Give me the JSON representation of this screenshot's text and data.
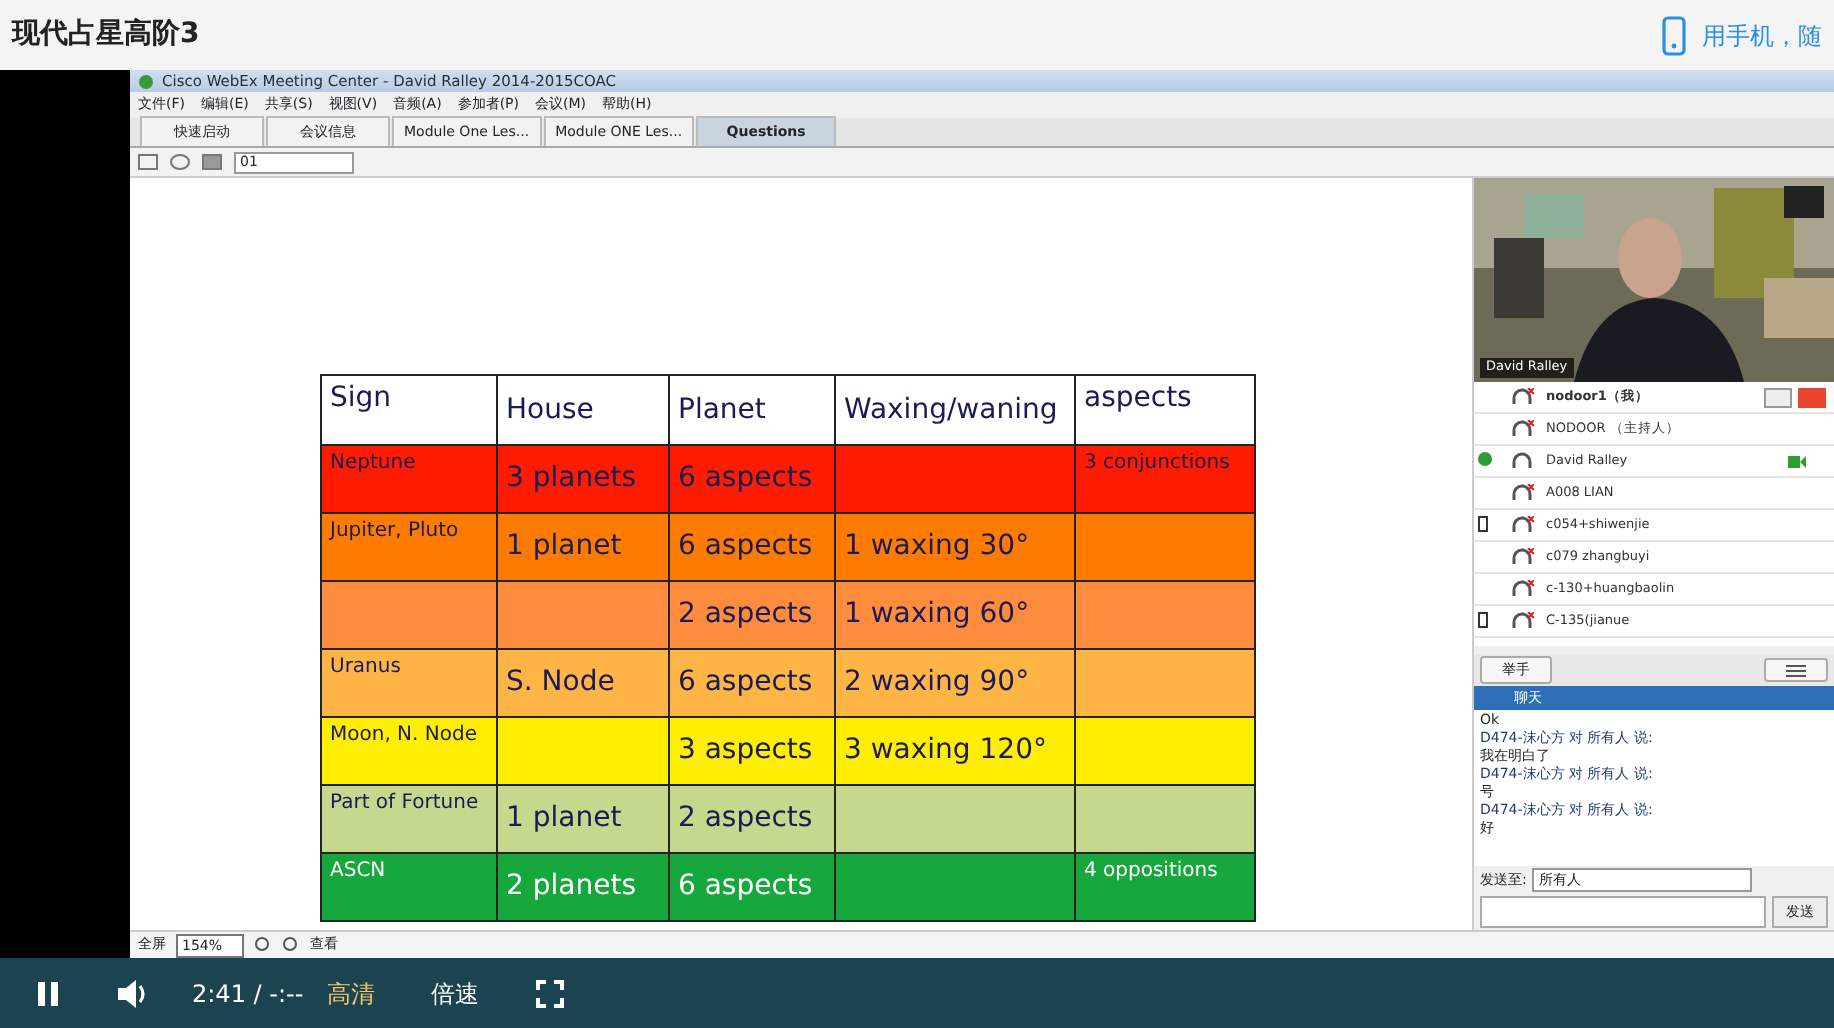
{
  "page": {
    "title": "现代占星高阶3",
    "mobile_link": "用手机，随"
  },
  "recording": {
    "window_title": "Cisco WebEx Meeting Center - David Ralley 2014-2015COAC",
    "menu": [
      "文件(F)",
      "编辑(E)",
      "共享(S)",
      "视图(V)",
      "音频(A)",
      "参加者(P)",
      "会议(M)",
      "帮助(H)"
    ],
    "tabs": [
      {
        "label": "快速启动",
        "selected": false
      },
      {
        "label": "会议信息",
        "selected": false
      },
      {
        "label": "Module One Les...",
        "selected": false
      },
      {
        "label": "Module ONE Les...",
        "selected": false
      },
      {
        "label": "Questions",
        "selected": true
      }
    ],
    "page_select": "01",
    "table": {
      "columns": [
        "Sign",
        "House",
        "Planet",
        "Waxing/waning",
        "aspects"
      ],
      "rows": [
        {
          "color": "#ff1a00",
          "cells": [
            "Neptune",
            "3 planets",
            "6 aspects",
            "",
            "3 conjunctions"
          ]
        },
        {
          "color": "#ff7b00",
          "cells": [
            "Jupiter, Pluto",
            "1 planet",
            "6 aspects",
            "1 waxing 30°",
            ""
          ]
        },
        {
          "color": "#ff8c3c",
          "cells": [
            "",
            "",
            "2 aspects",
            "1 waxing 60°",
            ""
          ]
        },
        {
          "color": "#ffb446",
          "cells": [
            "Uranus",
            "S. Node",
            "6 aspects",
            "2 waxing 90°",
            ""
          ]
        },
        {
          "color": "#ffee00",
          "cells": [
            "Moon, N. Node",
            "",
            "3 aspects",
            "3 waxing 120°",
            ""
          ]
        },
        {
          "color": "#c4d98c",
          "cells": [
            "Part of Fortune",
            "1 planet",
            "2 aspects",
            "",
            ""
          ]
        },
        {
          "color": "#16a83c",
          "cells": [
            "ASCN",
            "2 planets",
            "6 aspects",
            "",
            "4 oppositions"
          ]
        }
      ]
    },
    "bottom_toolbar": {
      "fullscreen": "全屏",
      "zoom": "154%",
      "view": "查看"
    },
    "video": {
      "presenter": "David Ralley"
    },
    "participants": [
      {
        "name": "nodoor1（我）",
        "kind": "self",
        "on_phone": false,
        "on_web": false,
        "muted": true
      },
      {
        "name": "NODOOR （主持人）",
        "kind": "other",
        "on_phone": false,
        "on_web": false,
        "muted": true
      },
      {
        "name": "David Ralley",
        "kind": "presenter",
        "on_phone": false,
        "on_web": true,
        "muted": false
      },
      {
        "name": "A008 LIAN",
        "kind": "other",
        "on_phone": false,
        "on_web": false,
        "muted": true
      },
      {
        "name": "c054+shiwenjie",
        "kind": "other",
        "on_phone": true,
        "on_web": false,
        "muted": true
      },
      {
        "name": "c079 zhangbuyi",
        "kind": "other",
        "on_phone": false,
        "on_web": false,
        "muted": true
      },
      {
        "name": "c-130+huangbaolin",
        "kind": "other",
        "on_phone": false,
        "on_web": false,
        "muted": true
      },
      {
        "name": "C-135(jianue",
        "kind": "other",
        "on_phone": true,
        "on_web": false,
        "muted": true
      }
    ],
    "raise_hand": "举手",
    "chat": {
      "title": "聊天",
      "messages": [
        {
          "kind": "text",
          "text": "Ok"
        },
        {
          "kind": "header",
          "text": "D474-沫心方 对 所有人 说:"
        },
        {
          "kind": "text",
          "text": "我在明白了"
        },
        {
          "kind": "header",
          "text": "D474-沫心方 对 所有人 说:"
        },
        {
          "kind": "text",
          "text": "号"
        },
        {
          "kind": "header",
          "text": "D474-沫心方 对 所有人 说:"
        },
        {
          "kind": "text",
          "text": "好"
        }
      ],
      "send_to_label": "发送至:",
      "send_to_value": "所有人",
      "send_button": "发送"
    }
  },
  "player": {
    "playing": true,
    "time": "2:41",
    "separator": "/",
    "duration": "-:--",
    "quality": "高清",
    "speed": "倍速"
  }
}
